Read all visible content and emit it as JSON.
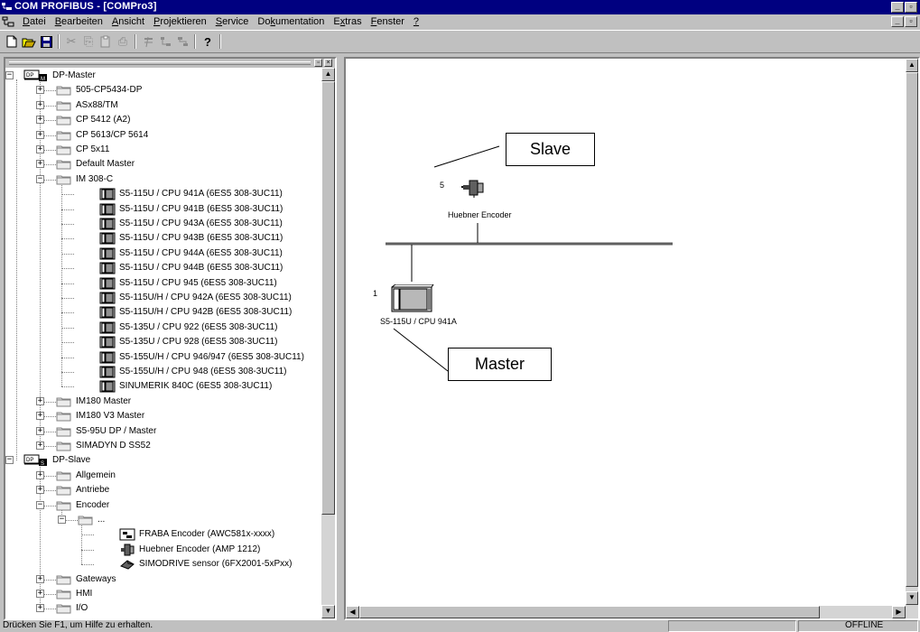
{
  "window": {
    "title": "COM PROFIBUS - [COMPro3]",
    "min_glyph": "_",
    "max_glyph": "▫",
    "close_glyph": "×"
  },
  "menu": [
    {
      "u": "D",
      "rest": "atei"
    },
    {
      "u": "B",
      "rest": "earbeiten"
    },
    {
      "u": "A",
      "rest": "nsicht"
    },
    {
      "u": "P",
      "rest": "rojektieren"
    },
    {
      "u": "S",
      "rest": "ervice"
    },
    {
      "pre": "Do",
      "u": "k",
      "rest": "umentation"
    },
    {
      "pre": "E",
      "u": "x",
      "rest": "tras"
    },
    {
      "u": "F",
      "rest": "enster"
    },
    {
      "u": "?",
      "rest": ""
    }
  ],
  "toolbar": {
    "new_icon": "new-file-icon",
    "open_icon": "open-folder-icon",
    "save_icon": "save-disk-icon",
    "cut_glyph": "✂",
    "copy_glyph": "⎘",
    "paste_glyph": "📋",
    "print_glyph": "⎙",
    "help_glyph": "?"
  },
  "tree": {
    "nodes": [
      {
        "label": "DP-Master",
        "level": 0,
        "kind": "dpmaster",
        "exp": "-"
      },
      {
        "label": "505-CP5434-DP",
        "level": 1,
        "kind": "folder",
        "exp": "+"
      },
      {
        "label": "ASx88/TM",
        "level": 1,
        "kind": "folder",
        "exp": "+"
      },
      {
        "label": "CP 5412 (A2)",
        "level": 1,
        "kind": "folder",
        "exp": "+"
      },
      {
        "label": "CP 5613/CP 5614",
        "level": 1,
        "kind": "folder",
        "exp": "+"
      },
      {
        "label": "CP 5x11",
        "level": 1,
        "kind": "folder",
        "exp": "+"
      },
      {
        "label": "Default Master",
        "level": 1,
        "kind": "folder",
        "exp": "+"
      },
      {
        "label": "IM 308-C",
        "level": 1,
        "kind": "folder",
        "exp": "-"
      },
      {
        "label": "S5-115U  / CPU 941A (6ES5 308-3UC11)",
        "level": 2,
        "kind": "device",
        "exp": ""
      },
      {
        "label": "S5-115U  / CPU 941B (6ES5 308-3UC11)",
        "level": 2,
        "kind": "device",
        "exp": ""
      },
      {
        "label": "S5-115U / CPU 943A (6ES5 308-3UC11)",
        "level": 2,
        "kind": "device",
        "exp": ""
      },
      {
        "label": "S5-115U / CPU 943B (6ES5 308-3UC11)",
        "level": 2,
        "kind": "device",
        "exp": ""
      },
      {
        "label": "S5-115U / CPU 944A (6ES5 308-3UC11)",
        "level": 2,
        "kind": "device",
        "exp": ""
      },
      {
        "label": "S5-115U / CPU 944B (6ES5 308-3UC11)",
        "level": 2,
        "kind": "device",
        "exp": ""
      },
      {
        "label": "S5-115U / CPU 945 (6ES5 308-3UC11)",
        "level": 2,
        "kind": "device",
        "exp": ""
      },
      {
        "label": "S5-115U/H / CPU 942A (6ES5 308-3UC11)",
        "level": 2,
        "kind": "device",
        "exp": ""
      },
      {
        "label": "S5-115U/H / CPU 942B (6ES5 308-3UC11)",
        "level": 2,
        "kind": "device",
        "exp": ""
      },
      {
        "label": "S5-135U / CPU 922 (6ES5 308-3UC11)",
        "level": 2,
        "kind": "device",
        "exp": ""
      },
      {
        "label": "S5-135U / CPU 928 (6ES5 308-3UC11)",
        "level": 2,
        "kind": "device",
        "exp": ""
      },
      {
        "label": "S5-155U/H / CPU 946/947 (6ES5 308-3UC11)",
        "level": 2,
        "kind": "device",
        "exp": ""
      },
      {
        "label": "S5-155U/H / CPU 948 (6ES5 308-3UC11)",
        "level": 2,
        "kind": "device",
        "exp": ""
      },
      {
        "label": "SINUMERIK 840C (6ES5 308-3UC11)",
        "level": 2,
        "kind": "device",
        "exp": ""
      },
      {
        "label": "IM180 Master",
        "level": 1,
        "kind": "folder",
        "exp": "+"
      },
      {
        "label": "IM180 V3 Master",
        "level": 1,
        "kind": "folder",
        "exp": "+"
      },
      {
        "label": "S5-95U DP / Master",
        "level": 1,
        "kind": "folder",
        "exp": "+"
      },
      {
        "label": "SIMADYN D SS52",
        "level": 1,
        "kind": "folder",
        "exp": "+"
      },
      {
        "label": "DP-Slave",
        "level": 0,
        "kind": "dpslave",
        "exp": "-"
      },
      {
        "label": "Allgemein",
        "level": 1,
        "kind": "folder",
        "exp": "+"
      },
      {
        "label": "Antriebe",
        "level": 1,
        "kind": "folder",
        "exp": "+"
      },
      {
        "label": "Encoder",
        "level": 1,
        "kind": "folder",
        "exp": "-"
      },
      {
        "label": "...",
        "level": 2,
        "kind": "folder",
        "exp": "-"
      },
      {
        "label": "FRABA Encoder (AWC581x-xxxx)",
        "level": 3,
        "kind": "fraba",
        "exp": ""
      },
      {
        "label": "Huebner Encoder (AMP 1212)",
        "level": 3,
        "kind": "huebner",
        "exp": ""
      },
      {
        "label": "SIMODRIVE sensor (6FX2001-5xPxx)",
        "level": 3,
        "kind": "simodrive",
        "exp": ""
      },
      {
        "label": "Gateways",
        "level": 1,
        "kind": "folder",
        "exp": "+"
      },
      {
        "label": "HMI",
        "level": 1,
        "kind": "folder",
        "exp": "+"
      },
      {
        "label": "I/O",
        "level": 1,
        "kind": "folder",
        "exp": "+"
      }
    ]
  },
  "diagram": {
    "slave_callout": "Slave",
    "master_callout": "Master",
    "slave_address": "5",
    "slave_name": "Huebner Encoder",
    "master_address": "1",
    "master_name": "S5-115U  / CPU 941A"
  },
  "status": {
    "message": "Drücken Sie F1, um Hilfe zu erhalten.",
    "mode": "OFFLINE"
  }
}
